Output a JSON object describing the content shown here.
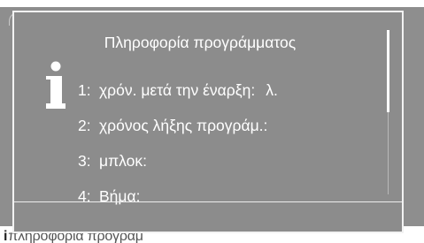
{
  "background": {
    "bottom_label": "πληροφορία προγράμ",
    "bottom_icon": "info-icon"
  },
  "dialog": {
    "title": "Πληροφορία προγράμματος",
    "icon": "info-icon",
    "rows": [
      {
        "number": "1:",
        "label": "χρόν. μετά την έναρξη:",
        "value": "λ."
      },
      {
        "number": "2:",
        "label": "χρόνος λήξης προγράμ.:",
        "value": ""
      },
      {
        "number": "3:",
        "label": "μπλοκ:",
        "value": ""
      },
      {
        "number": "4:",
        "label": "Βήμα:",
        "value": ""
      }
    ],
    "scroll_position": 0,
    "scroll_visible_fraction": 0.5
  },
  "colors": {
    "dialog_background": "#8c8c8c",
    "text": "#ffffff",
    "border": "#f2f2f2"
  }
}
